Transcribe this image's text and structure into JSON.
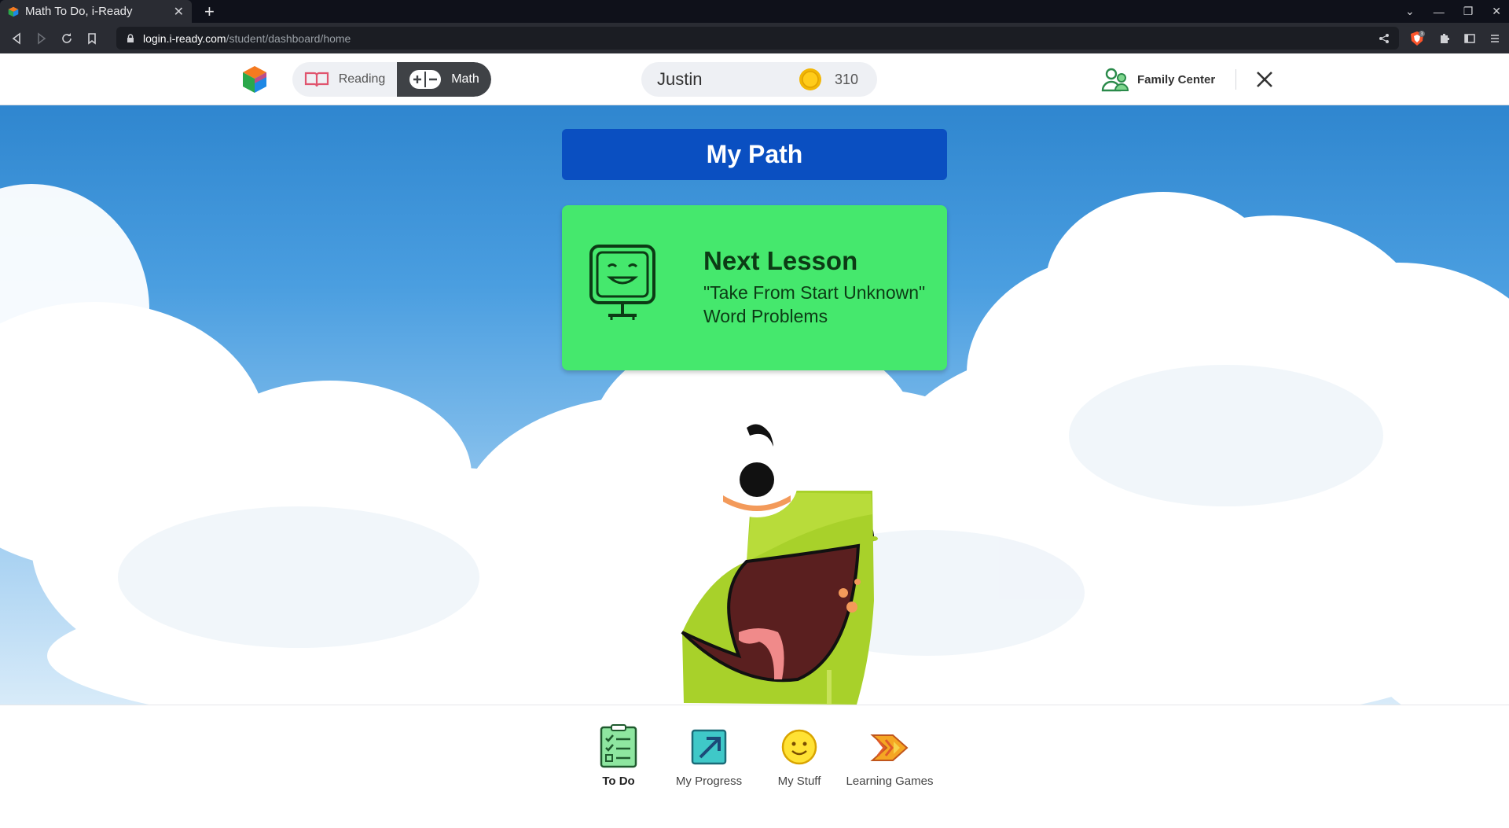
{
  "browser": {
    "tab_title": "Math To Do, i-Ready",
    "new_tab": "+",
    "url_domain": "login.i-ready.com",
    "url_path": "/student/dashboard/home",
    "brave_badge": "3"
  },
  "header": {
    "subjects": [
      {
        "label": "Reading",
        "selected": false
      },
      {
        "label": "Math",
        "selected": true
      }
    ],
    "user_name": "Justin",
    "coin_count": "310",
    "family_center": "Family Center"
  },
  "main": {
    "banner": "My Path",
    "lesson_card": {
      "heading": "Next Lesson",
      "title_line1": "\"Take From Start Unknown\"",
      "title_line2": "Word Problems"
    }
  },
  "bottom_nav": [
    {
      "label": "To Do",
      "active": true
    },
    {
      "label": "My Progress",
      "active": false
    },
    {
      "label": "My Stuff",
      "active": false
    },
    {
      "label": "Learning Games",
      "active": false
    }
  ],
  "colors": {
    "banner_bg": "#0a4fc1",
    "lesson_card_bg": "#45e86d",
    "math_toggle_bg": "#3f4246",
    "mascot_green": "#a8d12a"
  }
}
